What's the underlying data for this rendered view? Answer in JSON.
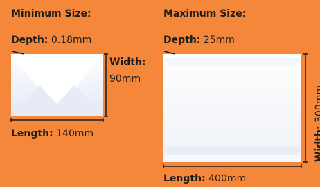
{
  "colors": {
    "background": "#f4873a",
    "envelope": "#ffffff",
    "text": "#1d1d1d"
  },
  "minimum": {
    "title": "Minimum Size:",
    "depth_label": "Depth:",
    "depth_value": "0.18mm",
    "width_label": "Width:",
    "width_value": "90mm",
    "length_label": "Length:",
    "length_value": "140mm"
  },
  "maximum": {
    "title": "Maximum Size:",
    "depth_label": "Depth:",
    "depth_value": "25mm",
    "width_label": "Width:",
    "width_value": "300mm",
    "length_label": "Length:",
    "length_value": "400mm"
  }
}
